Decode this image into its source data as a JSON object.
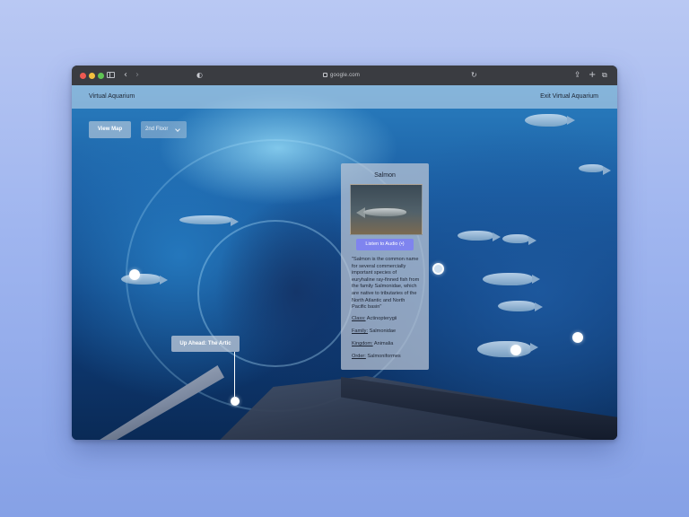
{
  "browser": {
    "url": "google.com"
  },
  "app": {
    "title": "Virtual Aquarium",
    "exit_label": "Exit Virtual Aquarium"
  },
  "controls": {
    "view_map_label": "View Map",
    "floor_selected": "2nd Floor"
  },
  "info_card": {
    "title": "Salmon",
    "listen_label": "Listen to Audio",
    "listen_icon": "(•)",
    "description": "\"Salmon is the common name for several commercially important species of euryhaline ray-finned fish from the family Salmonidae, which are native to tributaries of the North Atlantic and North Pacific basin\"",
    "taxonomy": [
      {
        "key": "Class:",
        "value": "Actinopterygii"
      },
      {
        "key": "Family:",
        "value": "Salmonidae"
      },
      {
        "key": "Kingdom:",
        "value": "Animalia"
      },
      {
        "key": "Order:",
        "value": "Salmoniformes"
      }
    ]
  },
  "navigation": {
    "up_ahead_label": "Up Ahead: The Artic"
  },
  "colors": {
    "accent_button": "#7f84ef",
    "page_background": "#9fb5ef"
  }
}
